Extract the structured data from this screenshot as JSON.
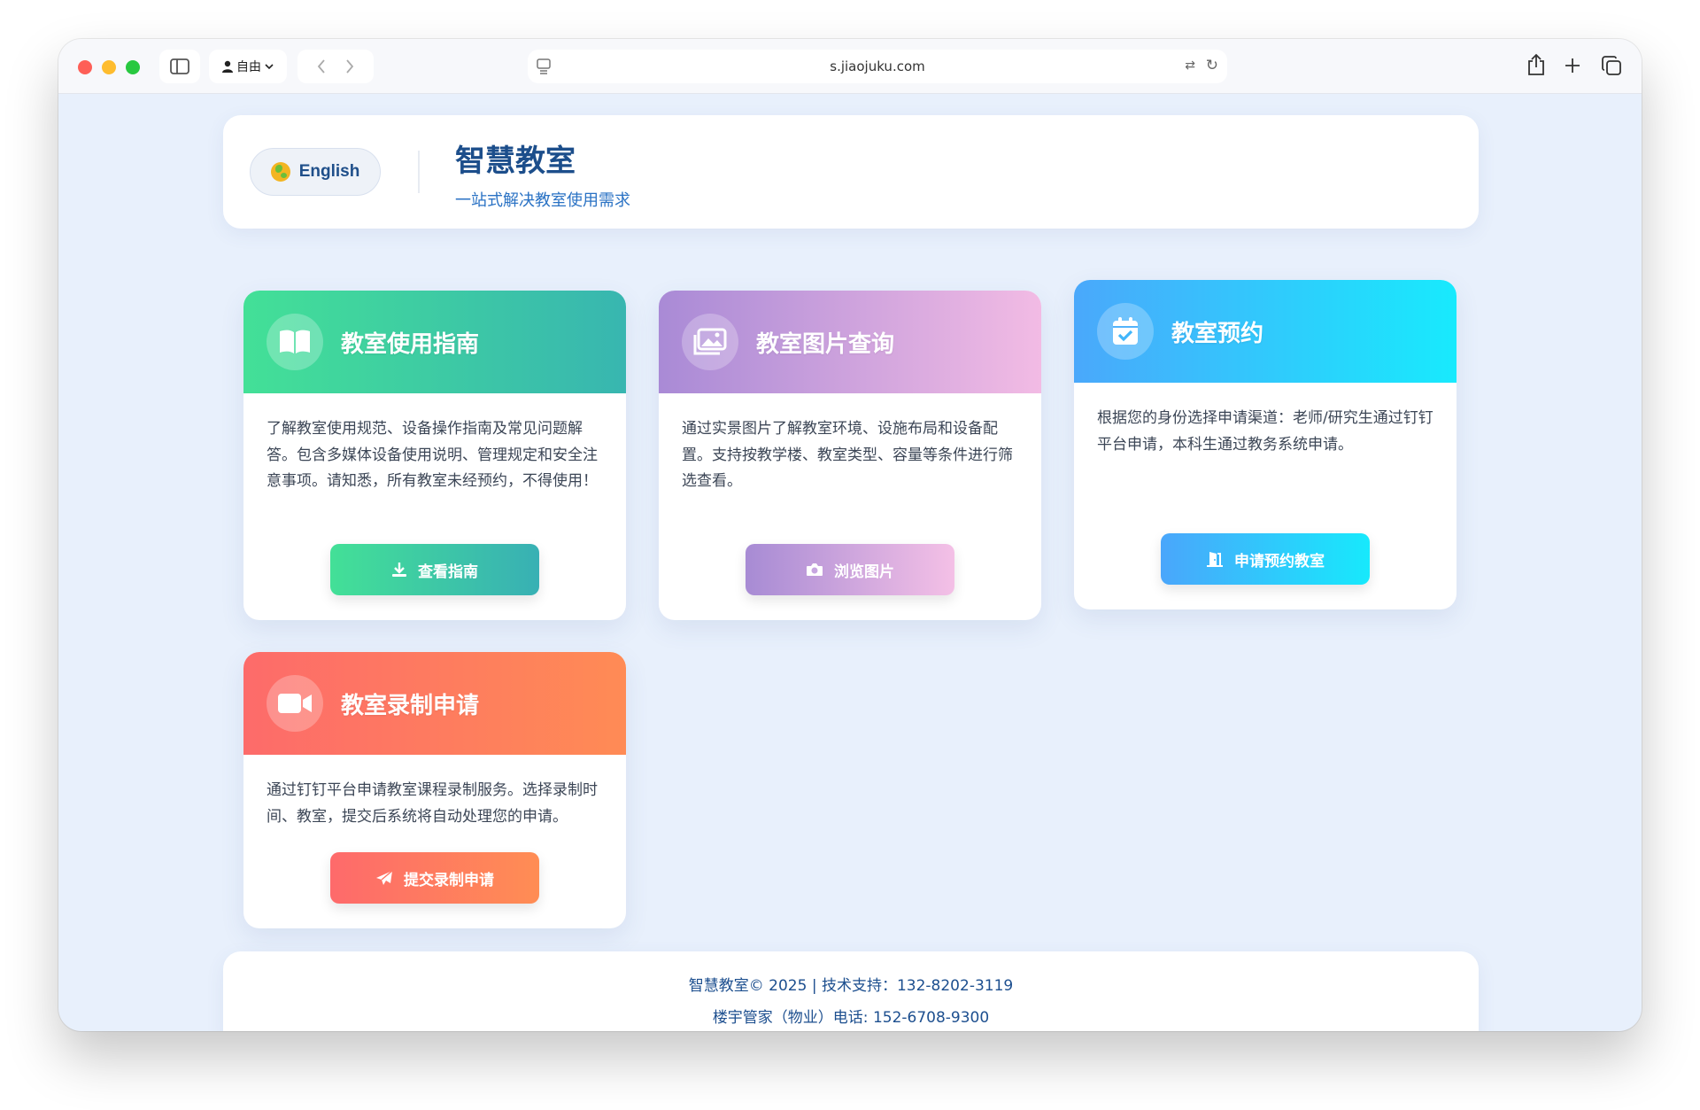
{
  "browser": {
    "profile_label": "自由",
    "url": "s.jiaojuku.com"
  },
  "header": {
    "lang_button": "English",
    "title": "智慧教室",
    "subtitle": "一站式解决教室使用需求"
  },
  "cards": [
    {
      "title": "教室使用指南",
      "icon": "book-icon",
      "description": "了解教室使用规范、设备操作指南及常见问题解答。包含多媒体设备使用说明、管理规定和安全注意事项。请知悉，所有教室未经预约，不得使用！",
      "button": "查看指南",
      "button_icon": "download-icon"
    },
    {
      "title": "教室图片查询",
      "icon": "images-icon",
      "description": "通过实景图片了解教室环境、设施布局和设备配置。支持按教学楼、教室类型、容量等条件进行筛选查看。",
      "button": "浏览图片",
      "button_icon": "camera-icon"
    },
    {
      "title": "教室预约",
      "icon": "calendar-check-icon",
      "description": "根据您的身份选择申请渠道：老师/研究生通过钉钉平台申请，本科生通过教务系统申请。",
      "button": "申请预约教室",
      "button_icon": "door-icon"
    },
    {
      "title": "教室录制申请",
      "icon": "video-camera-icon",
      "description": "通过钉钉平台申请教室课程录制服务。选择录制时间、教室，提交后系统将自动处理您的申请。",
      "button": "提交录制申请",
      "button_icon": "paper-plane-icon"
    }
  ],
  "footer": {
    "line1": "智慧教室© 2025 | 技术支持：132-8202-3119",
    "line2": "楼宇管家（物业）电话: 152-6708-9300"
  }
}
